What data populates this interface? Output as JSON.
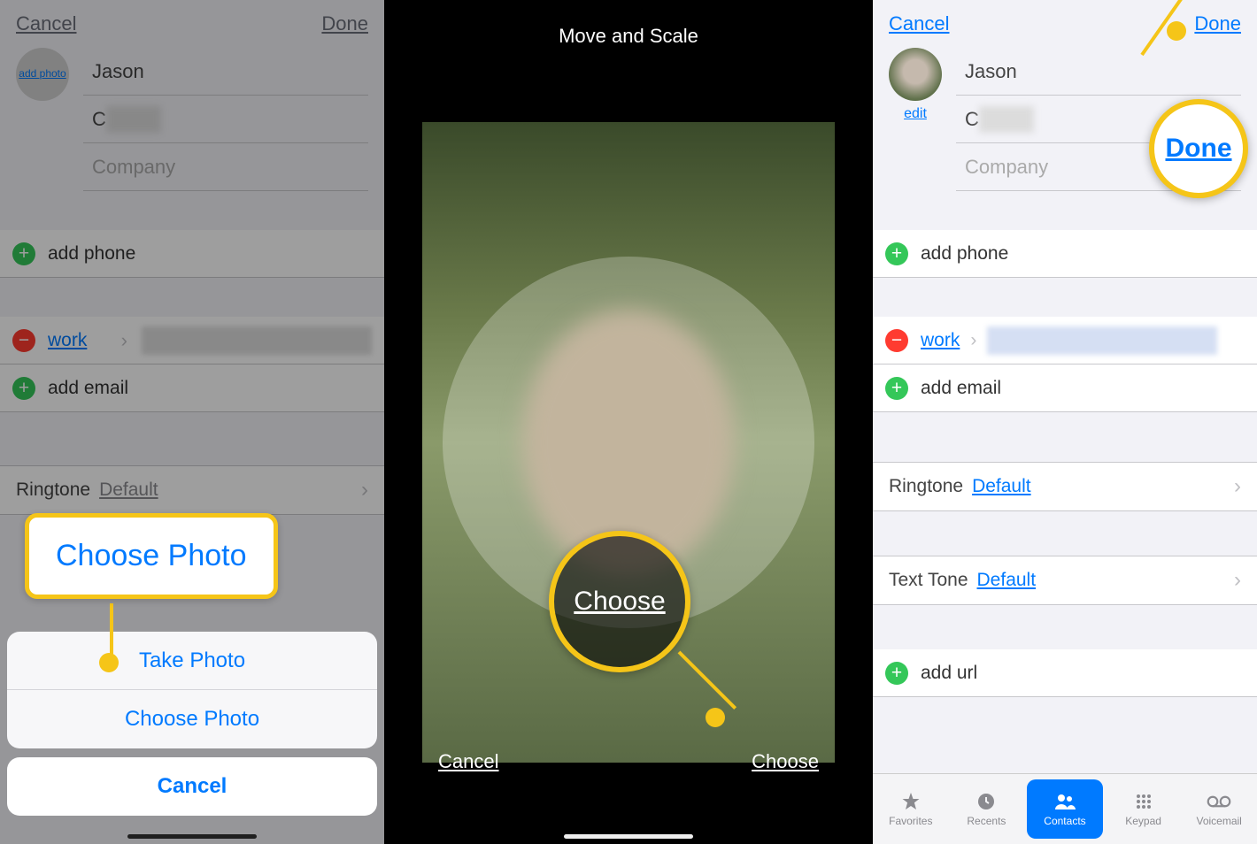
{
  "left": {
    "nav_cancel": "Cancel",
    "nav_done": "Done",
    "avatar_text": "add photo",
    "first_name": "Jason",
    "last_initial": "C",
    "company_ph": "Company",
    "add_phone": "add phone",
    "work_label": "work",
    "add_email": "add email",
    "ringtone_label": "Ringtone",
    "ringtone_value": "Default",
    "sheet_take_photo": "Take Photo",
    "sheet_choose_photo": "Choose Photo",
    "sheet_cancel": "Cancel",
    "callout_choose_photo": "Choose Photo"
  },
  "mid": {
    "title": "Move and Scale",
    "cancel": "Cancel",
    "choose": "Choose",
    "callout_choose": "Choose"
  },
  "right": {
    "nav_cancel": "Cancel",
    "nav_done": "Done",
    "edit": "edit",
    "first_name": "Jason",
    "last_initial": "C",
    "company_ph": "Company",
    "add_phone": "add phone",
    "work_label": "work",
    "add_email": "add email",
    "ringtone_label": "Ringtone",
    "ringtone_value": "Default",
    "texttone_label": "Text Tone",
    "texttone_value": "Default",
    "add_url": "add url",
    "callout_done": "Done",
    "tabs": {
      "favorites": "Favorites",
      "recents": "Recents",
      "contacts": "Contacts",
      "keypad": "Keypad",
      "voicemail": "Voicemail"
    }
  }
}
